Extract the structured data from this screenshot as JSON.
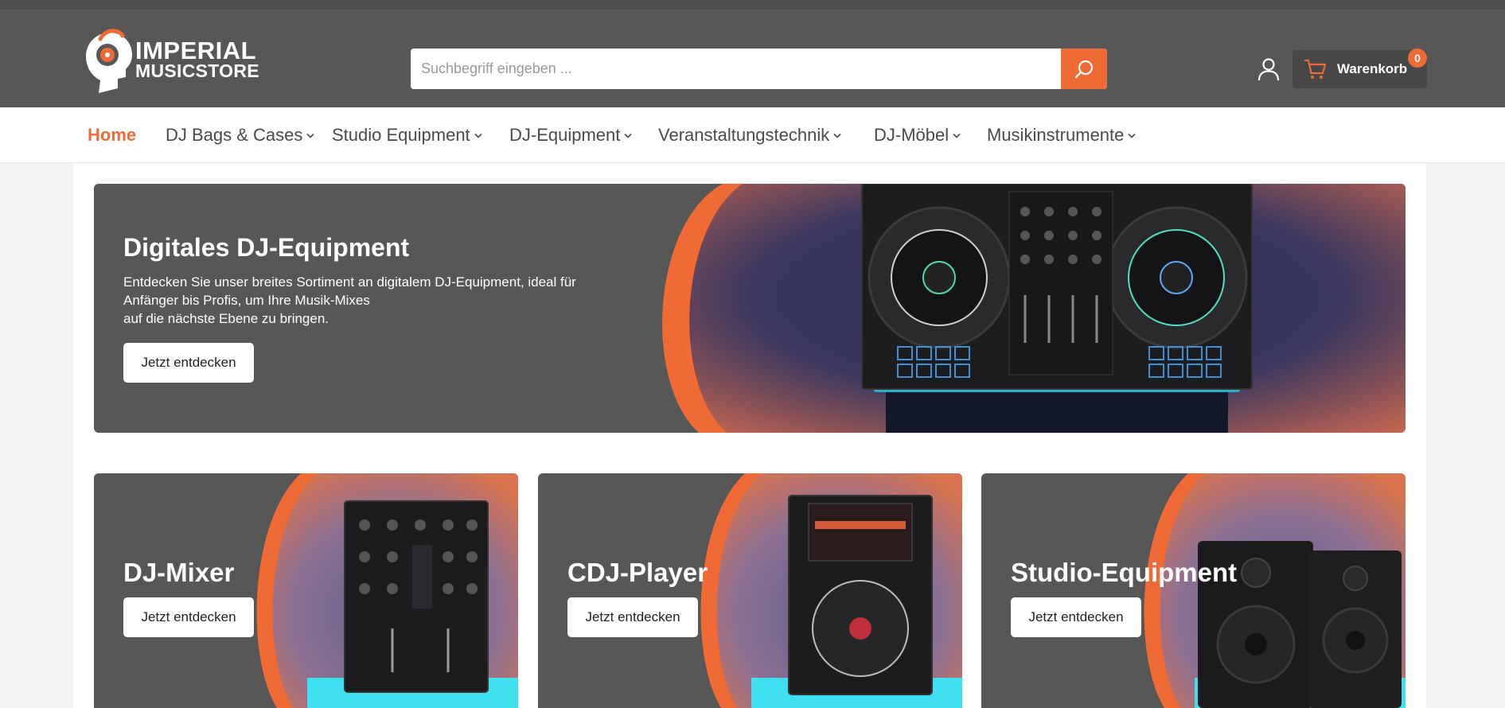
{
  "logo": {
    "line1": "IMPERIAL",
    "line2": "MUSICSTORE"
  },
  "search": {
    "placeholder": "Suchbegriff eingeben ..."
  },
  "cart": {
    "label": "Warenkorb",
    "count": "0"
  },
  "nav": {
    "items": [
      {
        "label": "Home",
        "active": true
      },
      {
        "label": "DJ Bags & Cases"
      },
      {
        "label": "Studio Equipment"
      },
      {
        "label": "DJ-Equipment"
      },
      {
        "label": "Veranstaltungstechnik"
      },
      {
        "label": "DJ-Möbel"
      },
      {
        "label": "Musikinstrumente"
      }
    ]
  },
  "hero": {
    "title": "Digitales DJ-Equipment",
    "text_line1": "Entdecken Sie unser breites Sortiment an digitalem DJ-Equipment, ideal für",
    "text_line2": "Anfänger bis Profis, um Ihre Musik-Mixes",
    "text_line3": "auf die nächste Ebene zu bringen.",
    "button": "Jetzt entdecken"
  },
  "cards": [
    {
      "title": "DJ-Mixer",
      "button": "Jetzt entdecken"
    },
    {
      "title": "CDJ-Player",
      "button": "Jetzt entdecken"
    },
    {
      "title": "Studio-Equipment",
      "button": "Jetzt entdecken"
    }
  ],
  "colors": {
    "accent": "#f06a35",
    "header": "#575757",
    "glow": "#3fe0f0"
  }
}
